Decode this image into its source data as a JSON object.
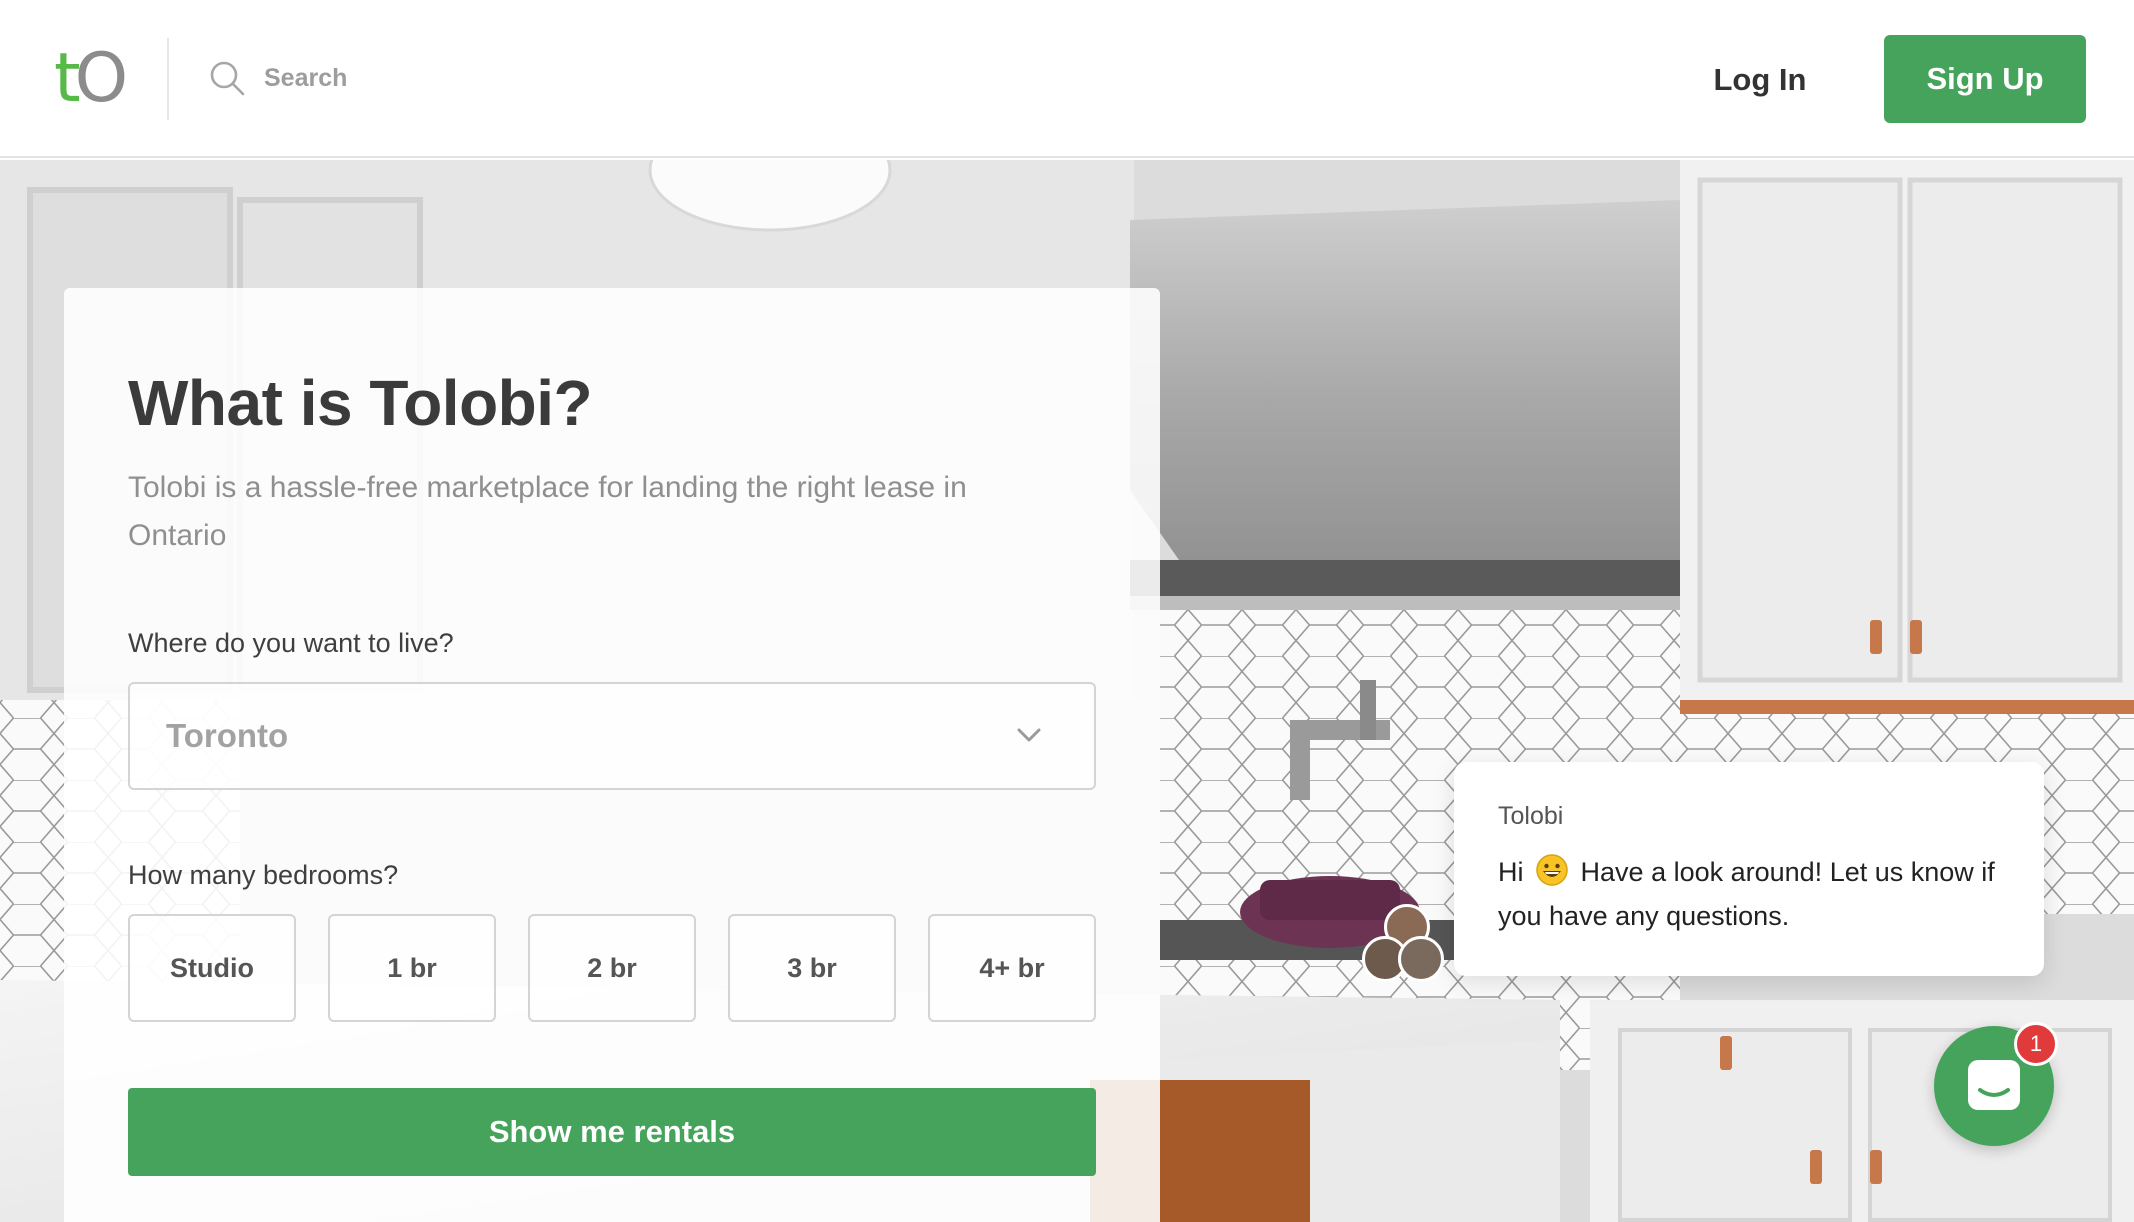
{
  "header": {
    "logo_t": "t",
    "logo_o": "O",
    "search_placeholder": "Search",
    "login_label": "Log In",
    "signup_label": "Sign Up"
  },
  "card": {
    "title": "What is Tolobi?",
    "subtitle": "Tolobi is a hassle-free marketplace for landing the right lease in Ontario",
    "location_label": "Where do you want to live?",
    "location_value": "Toronto",
    "bedrooms_label": "How many bedrooms?",
    "bedroom_options": [
      "Studio",
      "1 br",
      "2 br",
      "3 br",
      "4+ br"
    ],
    "cta_label": "Show me rentals"
  },
  "chat": {
    "sender": "Tolobi",
    "greeting": "Hi",
    "message": "Have a look around! Let us know if you have any questions.",
    "unread_count": "1"
  },
  "colors": {
    "brand_green": "#45a35b",
    "logo_green": "#56b948",
    "badge_red": "#e03a3a"
  },
  "icons": [
    "search-icon",
    "chevron-down-icon",
    "smiley-emoji-icon",
    "chat-launcher-icon"
  ]
}
